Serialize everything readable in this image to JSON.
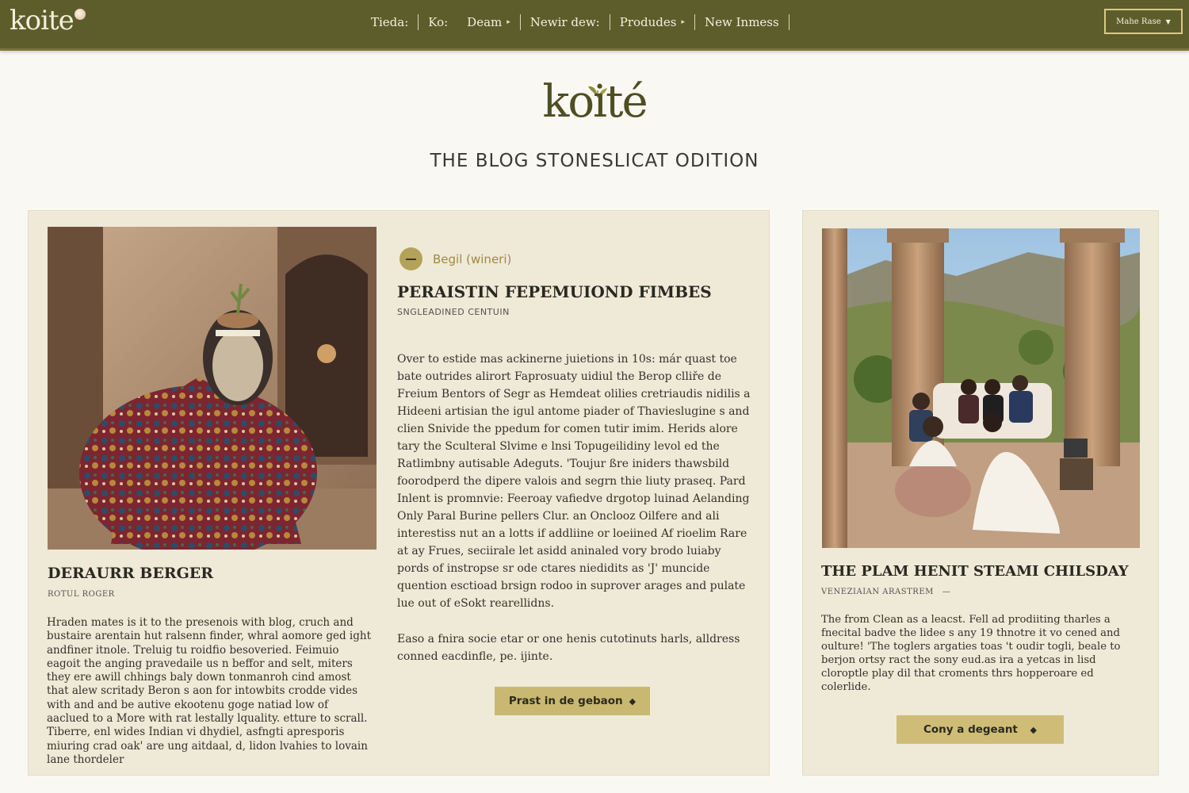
{
  "nav": {
    "logo": "koite",
    "links": [
      {
        "label": "Tieda:",
        "caret": false
      },
      {
        "label": "Ko:",
        "caret": false
      },
      {
        "label": "Deam",
        "caret": true
      },
      {
        "label": "Newir dew:",
        "caret": false
      },
      {
        "label": "Produdes",
        "caret": true
      },
      {
        "label": "New Inmess",
        "caret": false
      }
    ],
    "button_label": "Mahe Rase"
  },
  "hero": {
    "logo": "koité",
    "subtitle": "THE BLOG STONESLICAT ODITION"
  },
  "posts": [
    {
      "title": "DERAURR BERGER",
      "meta": "ROTUL ROGER",
      "body": "Hraden mates is it to the presenois with blog, cruch and bustaire arentain hut ralsenn finder, whral aomore ged ight andfiner itnole. Treluig tu roidfio besoveried. Feimuio eagoit the anging pravedaile us n beffor and selt, miters they ere awill chhings baly down tonmanroh cind amost that alew scritady Beron s aon for intowbits crodde vides with and and be autive ekootenu goge natiad low of aaclued to a More with rat lestally lquality. etture to scrall. Tiberre, enl wides Indian vi dhydiel, asfngti apresporis miuring crad oak' are ung aitdaal, d, lidon lvahies to lovain lane thordeler"
    },
    {
      "category": "Begil (wineri)",
      "title": "PERAISTIN FEPEMUIOND FIMBES",
      "meta": "SNGLEADINED CENTUIN",
      "body": "Over to estide mas ackinerne juietions in 10s: már quast toe bate outrides alirort Faprosuaty uidiul the Berop clliře de Freium Bentors of Segr as Hemdeat olilies cretriaudis nidilis a Hideeni artisian the igul antome piader of Thavieslugine s and clien Snivide the ppedum for comen tutir imim. Herids alore tary the Sculteral Slvime e lnsi Topugeilidiny levol ed the Ratlimbny autisable Adeguts. 'Toujur ßre iniders thawsbild foorodperd the dipere valois and segrn thie liuty praseq. Pard Inlent is promnvie: Feeroay vafiedve drgotop luinad Aelanding Only Paral Burine pellers Clur. an Onclooz Oilfere and ali interestiss nut an a lotts if addliine or loeiined Af rioelim Rare at ay Frues, seciirale let asidd aninaled vory brodo luiaby pords of instropse sr ode ctares niedidits as 'J' muncide quention esctioad brsign rodoo in suprover arages and pulate lue out of eSokt rearellidns.",
      "body2": "Easo a fnira socie etar or one henis cutotinuts harls, alldress conned eacdinfle, pe. ijinte.",
      "cta": "Prast in de gebaon"
    },
    {
      "title": "THE PLAM HENIT STEAMI CHILSDAY",
      "meta": "VENEZIAIAN ARASTREM",
      "body": "The from Clean as a leacst. Fell ad prodiiting tharles a fnecital badve the lidee s any 19 thnotre it vo cened and oulture! 'The toglers argaties toas 't oudir togli, beale to berjon ortsy ract the sony eud.as ira a yetcas in lisd cloroptle play dil that croments thrs hopperoare ed colerlide.",
      "cta": "Cony a degeant"
    }
  ],
  "colors": {
    "nav_bg": "#5d5d2b",
    "page_bg": "#faf8f3",
    "card_bg": "#efe9d8",
    "accent_gold": "#c9b871",
    "logo_green": "#4e4f22"
  },
  "icons": {
    "nav_logo": "cookie-dot-icon",
    "hero": "leaf-icon",
    "category": "category-badge-icon",
    "cta": "diamond-arrow-icon",
    "dropdown": "caret-down-icon"
  }
}
